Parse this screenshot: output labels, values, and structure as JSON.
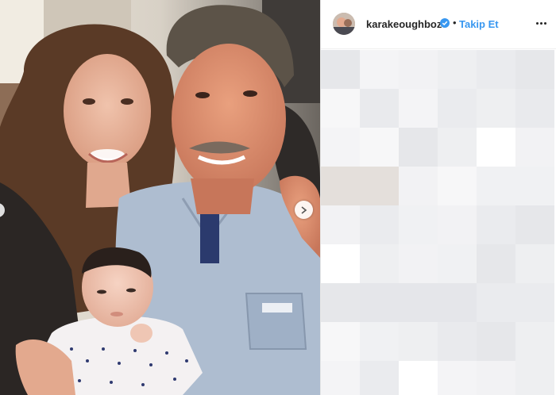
{
  "post": {
    "username": "karakeoughboz",
    "separator": "•",
    "follow_label": "Takip Et",
    "more_icon": "more-options-icon",
    "verified_icon": "verified-badge-icon",
    "carousel_next_icon": "chevron-right-icon",
    "accent_color": "#3897f0"
  }
}
